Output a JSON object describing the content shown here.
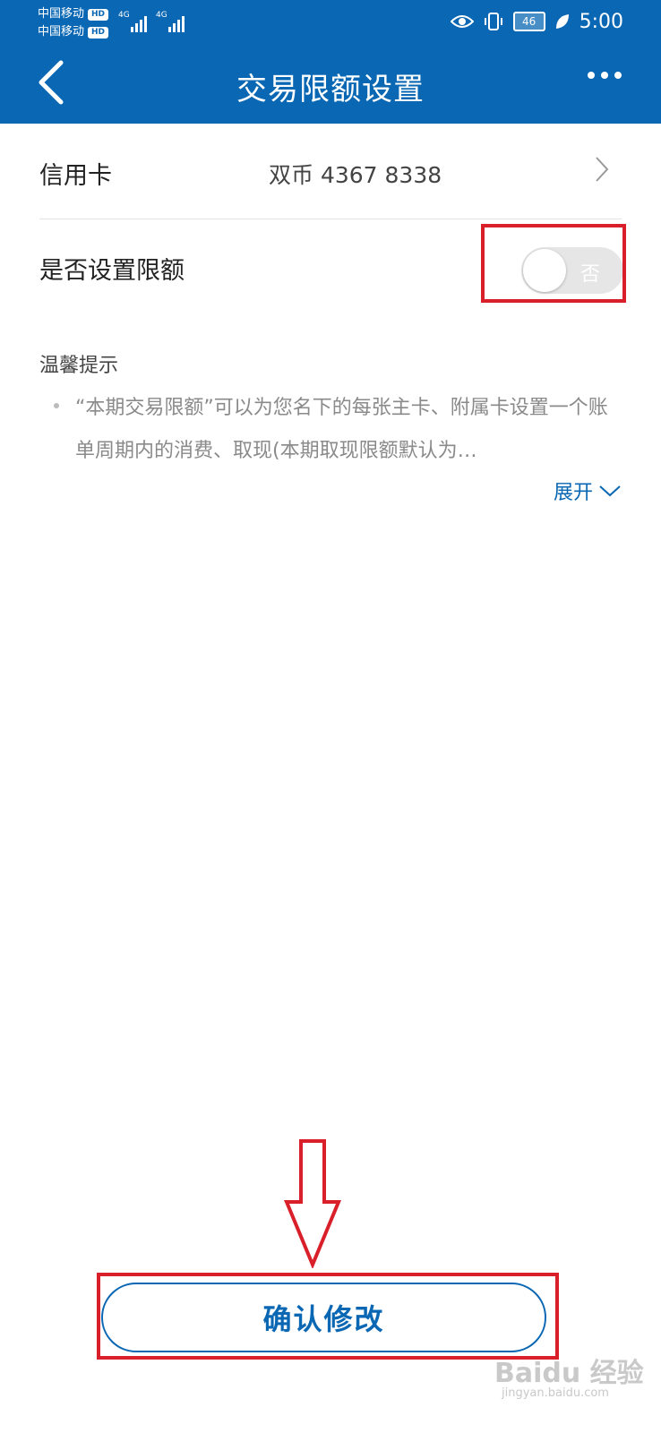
{
  "status_bar": {
    "carrier1": "中国移动",
    "carrier2": "中国移动",
    "hd_badge": "HD",
    "net1": "4G",
    "net2": "4G",
    "battery": "46",
    "time": "5:00",
    "icons": [
      "eye-icon",
      "vibrate-icon",
      "battery-icon",
      "leaf-icon"
    ]
  },
  "header": {
    "title": "交易限额设置",
    "color": "#0a67b3"
  },
  "card_row": {
    "label": "信用卡",
    "value": "双币 4367       8338"
  },
  "limit_row": {
    "label": "是否设置限额",
    "toggle_text": "否",
    "toggle_on": false
  },
  "tips": {
    "title": "温馨提示",
    "text": "“本期交易限额”可以为您名下的每张主卡、附属卡设置一个账单周期内的消费、取现(本期取现限额默认为…",
    "expand": "展开"
  },
  "confirm_button": {
    "label": "确认修改"
  },
  "watermark": {
    "text": "Baidu 经验",
    "sub": "jingyan.baidu.com"
  },
  "annotation_color": "#d9202a"
}
